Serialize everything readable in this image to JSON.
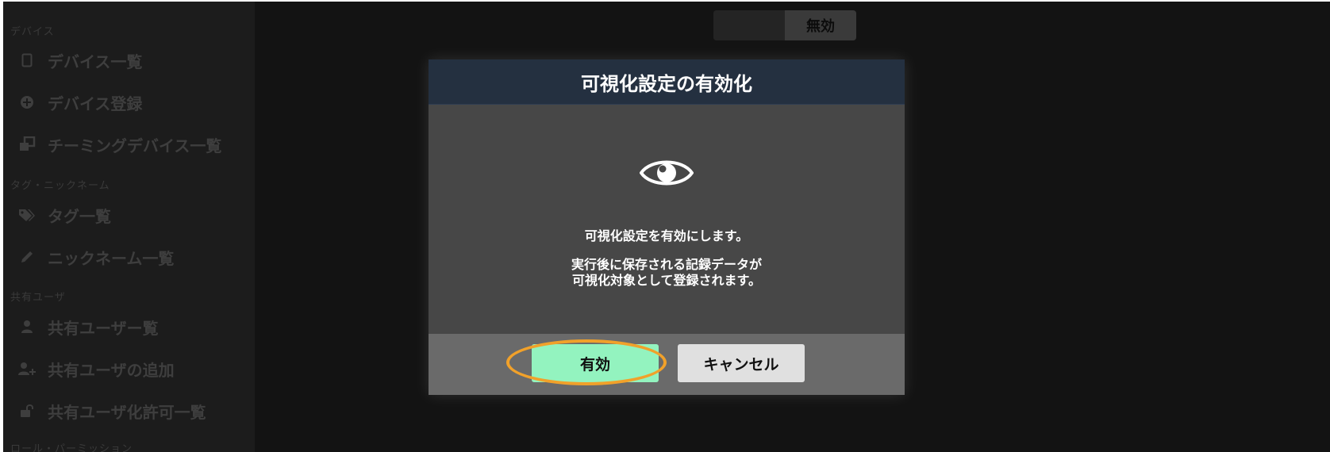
{
  "sidebar": {
    "sections": [
      {
        "label": "デバイス",
        "items": [
          {
            "label": "デバイス一覧",
            "icon": "tablet-icon"
          },
          {
            "label": "デバイス登録",
            "icon": "plus-circle-icon"
          },
          {
            "label": "チーミングデバイス一覧",
            "icon": "clone-icon"
          }
        ]
      },
      {
        "label": "タグ・ニックネーム",
        "items": [
          {
            "label": "タグ一覧",
            "icon": "tags-icon"
          },
          {
            "label": "ニックネーム一覧",
            "icon": "pencil-icon"
          }
        ]
      },
      {
        "label": "共有ユーザ",
        "items": [
          {
            "label": "共有ユーザー覧",
            "icon": "user-icon"
          },
          {
            "label": "共有ユーザの追加",
            "icon": "user-plus-icon"
          },
          {
            "label": "共有ユーザ化許可一覧",
            "icon": "unlock-icon"
          }
        ]
      },
      {
        "label": "ロール・パーミッション",
        "items": []
      }
    ]
  },
  "main": {
    "toggle_label": "無効"
  },
  "modal": {
    "title": "可視化設定の有効化",
    "icon": "eye-icon",
    "message_1": "可視化設定を有効にします。",
    "message_2_line1": "実行後に保存される記録データが",
    "message_2_line2": "可視化対象として登録されます。",
    "confirm_label": "有効",
    "cancel_label": "キャンセル"
  },
  "colors": {
    "modal_header": "#243040",
    "confirm_button": "#93f3bf",
    "highlight": "#f1a12a"
  }
}
